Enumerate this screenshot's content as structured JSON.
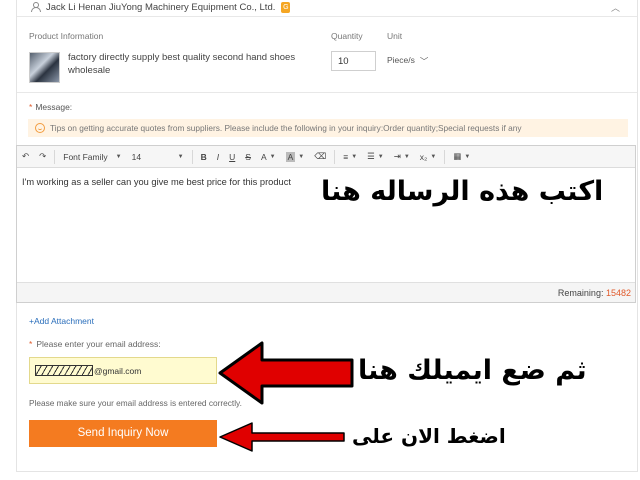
{
  "supplier": {
    "name": "Jack Li Henan JiuYong Machinery Equipment Co., Ltd."
  },
  "product_table": {
    "headers": {
      "product": "Product Information",
      "quantity": "Quantity",
      "unit": "Unit"
    },
    "product_name": "factory directly supply best quality second hand shoes wholesale",
    "quantity_value": "10",
    "unit_value": "Piece/s"
  },
  "message": {
    "label": "Message:",
    "required_mark": "*",
    "tips": "Tips on getting accurate quotes from suppliers. Please include the following in your inquiry:Order quantity;Special requests if any"
  },
  "toolbar": {
    "font_family": "Font Family",
    "font_size": "14",
    "bold": "B",
    "italic": "I",
    "underline": "U",
    "strike": "S",
    "font_color": "A",
    "highlight": "A",
    "subscript": "x₂"
  },
  "editor": {
    "text": "I'm working as a seller can you give me best price for this product",
    "remaining_label": "Remaining:",
    "remaining_count": "15482"
  },
  "attachment": {
    "label": "Add Attachment"
  },
  "email": {
    "label": "Please enter your email address:",
    "required_mark": "*",
    "value_suffix": "@gmail.com",
    "note": "Please make sure your email address is entered correctly."
  },
  "send_button": {
    "label": "Send Inquiry Now"
  },
  "annotations": {
    "write_message": "اكتب هذه الرساله هنا",
    "enter_email": "ثم ضع ايميلك هنا",
    "press_now": "اضغط الان على"
  },
  "colors": {
    "accent_orange": "#f47b20",
    "arrow_red": "#e00000",
    "link_blue": "#2a6ebb",
    "email_field_bg": "#fffbd0"
  }
}
